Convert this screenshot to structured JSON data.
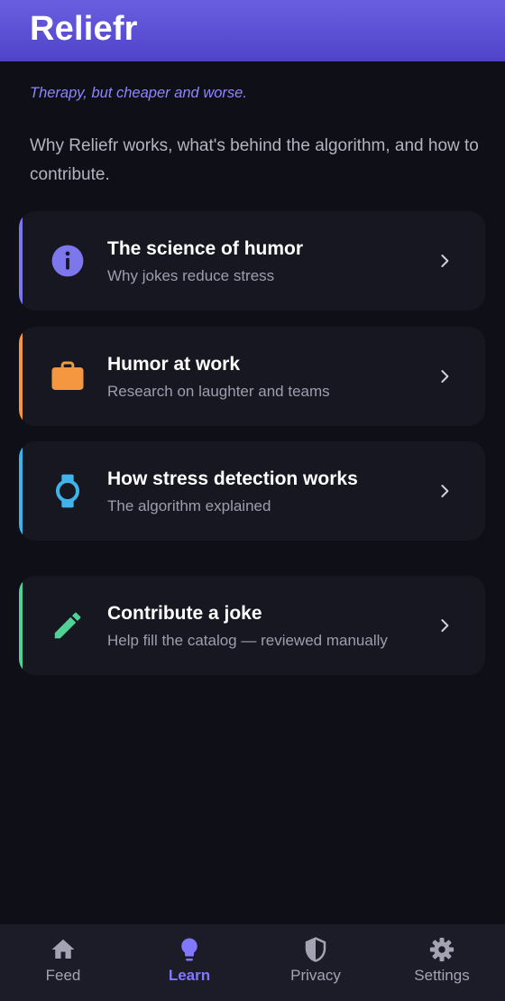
{
  "app": {
    "title": "Reliefr"
  },
  "tagline": "Therapy, but cheaper and worse.",
  "intro": "Why Reliefr works, what's behind the algorithm, and how to contribute.",
  "cards": [
    {
      "title": "The science of humor",
      "subtitle": "Why jokes reduce stress",
      "icon": "info-icon",
      "accent": "#7d77ee"
    },
    {
      "title": "Humor at work",
      "subtitle": "Research on laughter and teams",
      "icon": "briefcase-icon",
      "accent": "#f59640"
    },
    {
      "title": "How stress detection works",
      "subtitle": "The algorithm explained",
      "icon": "watch-icon",
      "accent": "#3fb3ea"
    },
    {
      "title": "Contribute a joke",
      "subtitle": "Help fill the catalog — reviewed manually",
      "icon": "pencil-icon",
      "accent": "#52d197"
    }
  ],
  "nav": [
    {
      "label": "Feed",
      "icon": "home-icon",
      "active": false
    },
    {
      "label": "Learn",
      "icon": "lightbulb-icon",
      "active": true
    },
    {
      "label": "Privacy",
      "icon": "shield-icon",
      "active": false
    },
    {
      "label": "Settings",
      "icon": "gear-icon",
      "active": false
    }
  ],
  "colors": {
    "background": "#0f0f17",
    "card": "#171722",
    "accent_primary": "#8178ff",
    "nav_background": "#1c1c28"
  }
}
